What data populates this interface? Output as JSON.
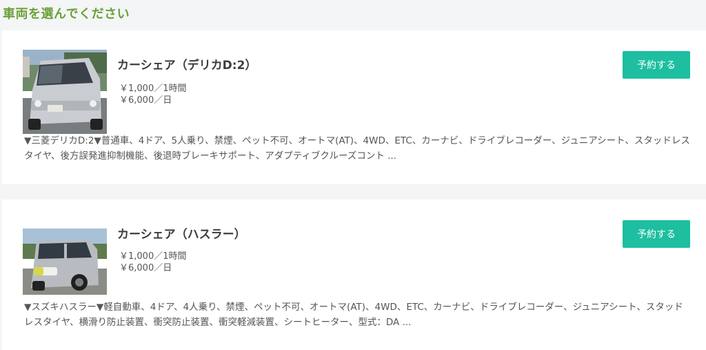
{
  "page": {
    "title": "車両を選んでください"
  },
  "vehicles": [
    {
      "name": "カーシェア（デリカD:2）",
      "price_hour": "￥1,000／1時間",
      "price_day": "￥6,000／日",
      "reserve_label": "予約する",
      "description": "▼三菱デリカD:2▼普通車、4ドア、5人乗り、禁煙、ペット不可、オートマ(AT)、4WD、ETC、カーナビ、ドライブレコーダー、ジュニアシート、スタッドレスタイヤ、後方誤発進抑制機能、後退時ブレーキサポート、アダプティブクルーズコント ..."
    },
    {
      "name": "カーシェア（ハスラー）",
      "price_hour": "￥1,000／1時間",
      "price_day": "￥6,000／日",
      "reserve_label": "予約する",
      "description": "▼スズキハスラー▼軽自動車、4ドア、4人乗り、禁煙、ペット不可、オートマ(AT)、4WD、ETC、カーナビ、ドライブレコーダー、ジュニアシート、スタッドレスタイヤ、横滑り防止装置、衝突防止装置、衝突軽減装置、シートヒーター、型式：DA ..."
    }
  ],
  "colors": {
    "title_green": "#6aa038",
    "button_teal": "#1dbfa0",
    "page_background": "#f4f5f6",
    "card_background": "#ffffff"
  }
}
